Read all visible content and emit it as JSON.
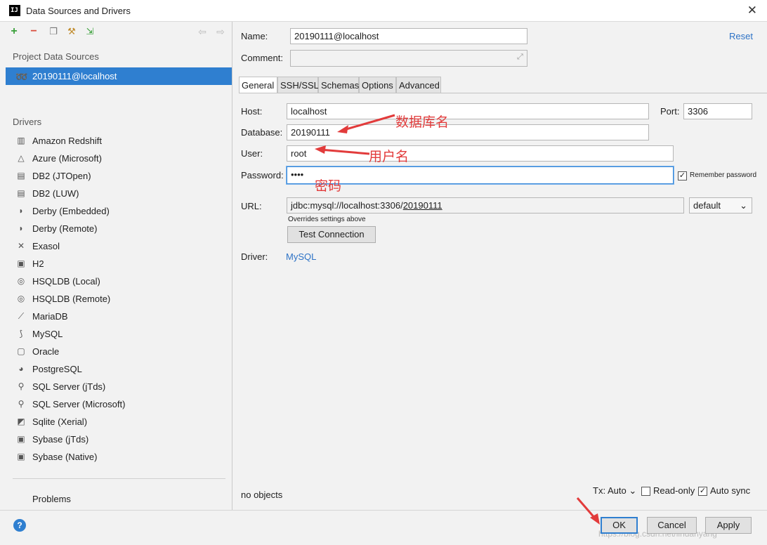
{
  "window": {
    "title": "Data Sources and Drivers",
    "app_icon_text": "IJ"
  },
  "left": {
    "project_sources_heading": "Project Data Sources",
    "selected_source": "20190111@localhost",
    "drivers_heading": "Drivers",
    "drivers": [
      "Amazon Redshift",
      "Azure (Microsoft)",
      "DB2 (JTOpen)",
      "DB2 (LUW)",
      "Derby (Embedded)",
      "Derby (Remote)",
      "Exasol",
      "H2",
      "HSQLDB (Local)",
      "HSQLDB (Remote)",
      "MariaDB",
      "MySQL",
      "Oracle",
      "PostgreSQL",
      "SQL Server (jTds)",
      "SQL Server (Microsoft)",
      "Sqlite (Xerial)",
      "Sybase (jTds)",
      "Sybase (Native)"
    ],
    "problems": "Problems"
  },
  "form": {
    "name_label": "Name:",
    "name_value": "20190111@localhost",
    "comment_label": "Comment:",
    "comment_value": "",
    "reset": "Reset",
    "tabs": [
      "General",
      "SSH/SSL",
      "Schemas",
      "Options",
      "Advanced"
    ],
    "host_label": "Host:",
    "host_value": "localhost",
    "port_label": "Port:",
    "port_value": "3306",
    "database_label": "Database:",
    "database_value": "20190111",
    "user_label": "User:",
    "user_value": "root",
    "password_label": "Password:",
    "password_value": "••••",
    "remember_password": "Remember password",
    "url_label": "URL:",
    "url_prefix": "jdbc:mysql://localhost:3306/",
    "url_db": "20190111",
    "url_mode": "default",
    "overrides_note": "Overrides settings above",
    "test_connection": "Test Connection",
    "driver_label": "Driver:",
    "driver_value": "MySQL",
    "status": "no objects",
    "tx": "Tx: Auto",
    "read_only": "Read-only",
    "auto_sync": "Auto sync"
  },
  "annotations": {
    "database": "数据库名",
    "user": "用户名",
    "password": "密码"
  },
  "buttons": {
    "ok": "OK",
    "cancel": "Cancel",
    "apply": "Apply",
    "help": "?"
  },
  "watermark": "https://blog.csdn.net/lindanyang",
  "colors": {
    "selection": "#2f7fd0",
    "annotation": "#e23b3b",
    "link": "#2e73c6"
  }
}
